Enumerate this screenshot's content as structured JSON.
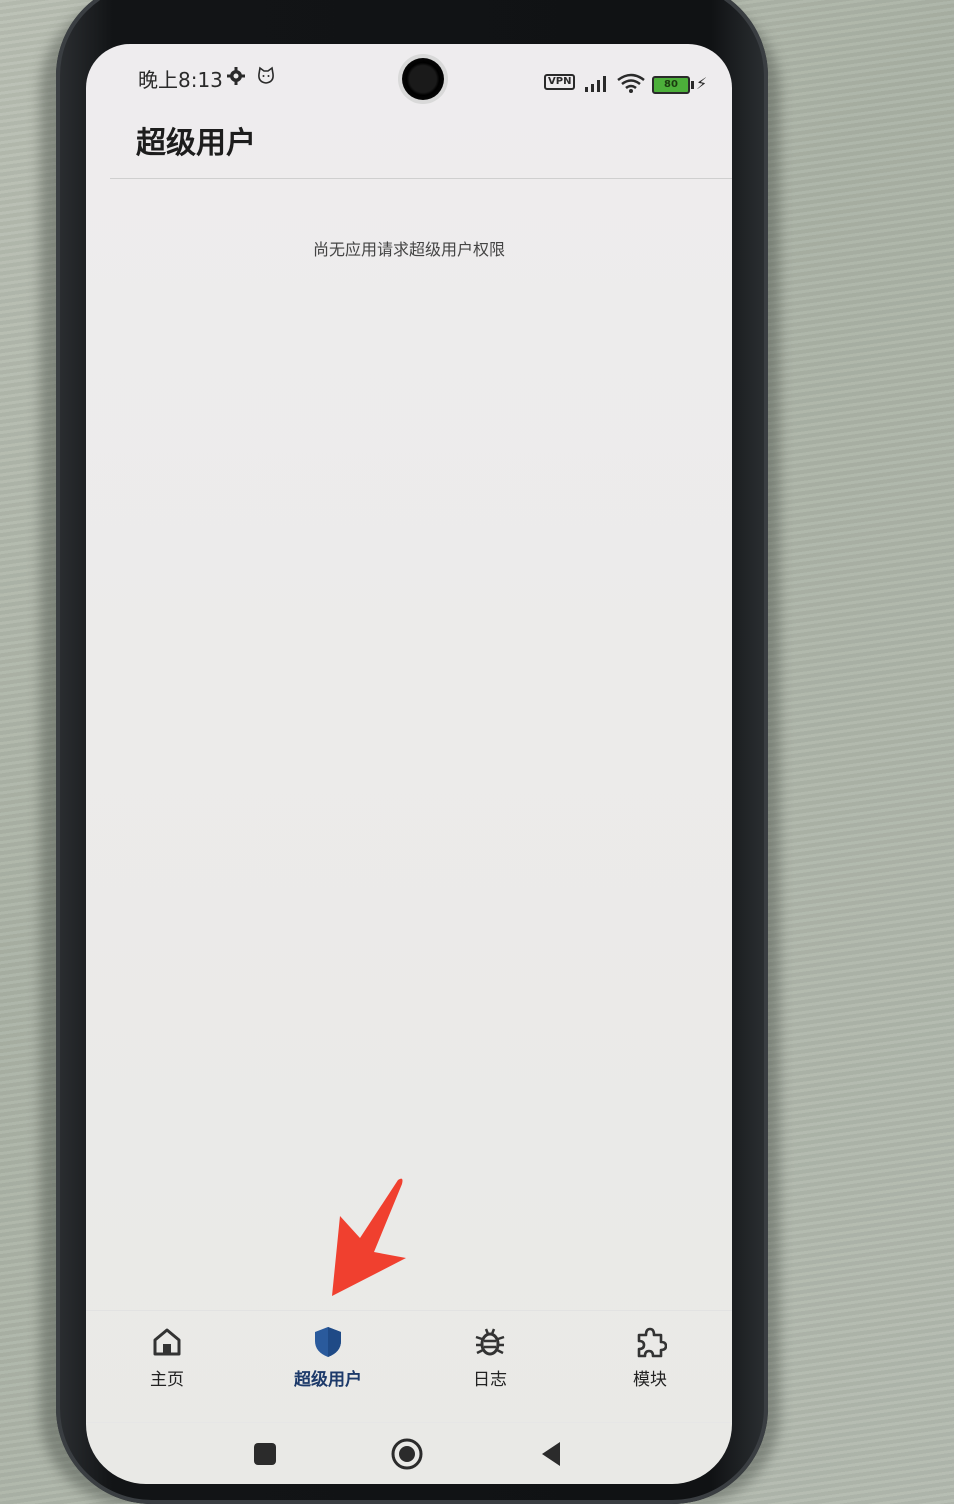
{
  "status_bar": {
    "time": "晚上8:13",
    "vpn": "VPN",
    "battery": "80"
  },
  "header": {
    "title": "超级用户"
  },
  "main": {
    "empty_message": "尚无应用请求超级用户权限"
  },
  "bottom_nav": {
    "items": [
      {
        "label": "主页",
        "icon": "home-icon"
      },
      {
        "label": "超级用户",
        "icon": "shield-icon",
        "active": true
      },
      {
        "label": "日志",
        "icon": "bug-icon"
      },
      {
        "label": "模块",
        "icon": "puzzle-icon"
      }
    ]
  },
  "system_nav": {
    "buttons": [
      "recents-button",
      "home-button",
      "back-button"
    ]
  },
  "colors": {
    "active_nav": "#1d3a6a",
    "annotation_arrow": "#f0402f",
    "screen_bg": "#ecebea"
  }
}
